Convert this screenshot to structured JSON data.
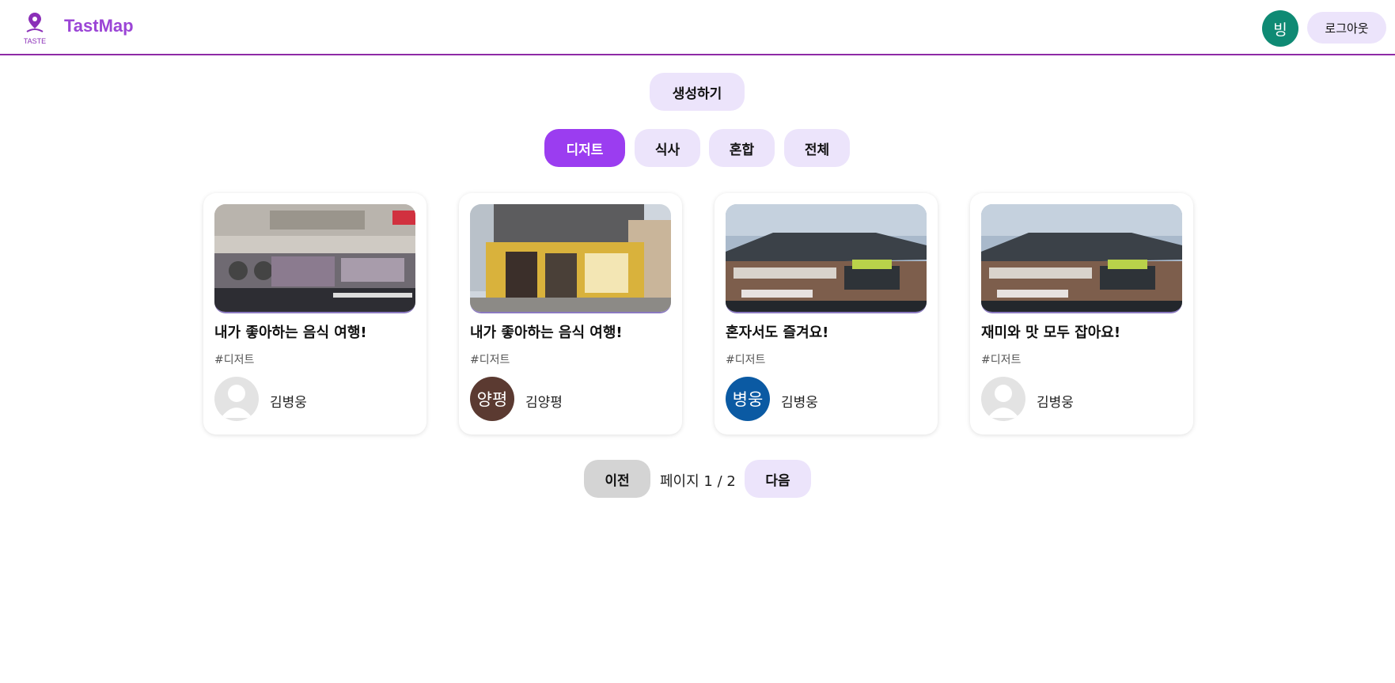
{
  "app": {
    "brand": "TastMap",
    "logo_text": "TASTE",
    "user_initial": "빙",
    "logout_label": "로그아웃",
    "accent": "#9b3df0"
  },
  "create_label": "생성하기",
  "tabs": [
    {
      "label": "디저트",
      "active": true
    },
    {
      "label": "식사",
      "active": false
    },
    {
      "label": "혼합",
      "active": false
    },
    {
      "label": "전체",
      "active": false
    }
  ],
  "cards": [
    {
      "title": "내가 좋아하는 음식 여행!",
      "tag": "#디저트",
      "author": "김병웅",
      "avatar_text": "",
      "avatar_color": "#d9d9d9",
      "image": "cafe-storefront-photo"
    },
    {
      "title": "내가 좋아하는 음식 여행!",
      "tag": "#디저트",
      "author": "김양평",
      "avatar_text": "양평",
      "avatar_color": "#5b3a31",
      "image": "mega-coffee-storefront-photo"
    },
    {
      "title": "혼자서도 즐겨요!",
      "tag": "#디저트",
      "author": "김병웅",
      "avatar_text": "병웅",
      "avatar_color": "#0b5aa3",
      "image": "restaurant-building-photo"
    },
    {
      "title": "재미와 맛 모두 잡아요!",
      "tag": "#디저트",
      "author": "김병웅",
      "avatar_text": "",
      "avatar_color": "#d9d9d9",
      "image": "restaurant-building-photo"
    }
  ],
  "pager": {
    "prev_label": "이전",
    "page_prefix": "페이지",
    "page_current": "1 / 2",
    "next_label": "다음"
  }
}
